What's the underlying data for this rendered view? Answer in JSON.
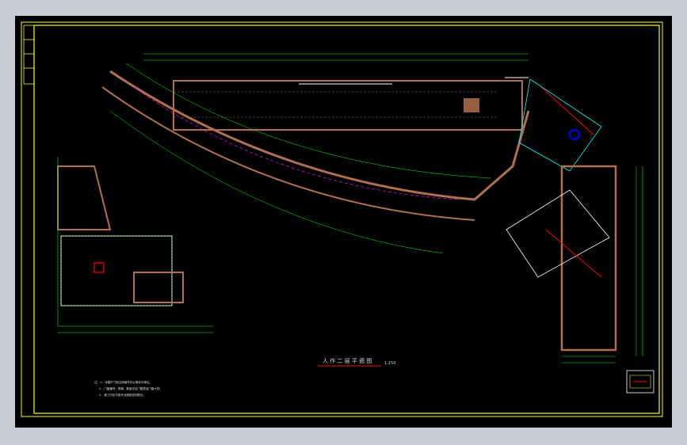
{
  "drawing": {
    "title": "人 作 二 层 平 面 图",
    "scale": "1:150",
    "notes": [
      "注：1. 本图尺寸除注明者外均以毫米为单位。",
      "2. 门窗编号、规格、数量详见门窗表及门窗大样。",
      "3. 施工时应与各专业图纸密切配合。"
    ]
  },
  "colors": {
    "background": "#000000",
    "frame": "#ffff00",
    "wall": "#b07050",
    "dimension": "#00ff00",
    "furniture": "#ffffff",
    "glazing": "#00ffff",
    "accent_red": "#ff0000",
    "accent_blue": "#0000ff",
    "accent_magenta": "#ff00ff",
    "viewport": "#c9cdd6"
  }
}
